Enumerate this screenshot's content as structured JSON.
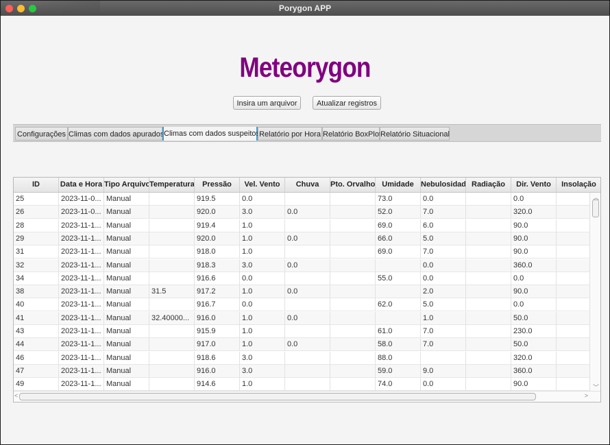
{
  "window": {
    "title": "Porygon APP"
  },
  "app": {
    "title": "Meteorygon"
  },
  "buttons": {
    "insert_file": "Insira um arquivor",
    "update_records": "Atualizar registros"
  },
  "tabs": [
    {
      "label": "Configurações",
      "active": false
    },
    {
      "label": "Climas com dados apurados",
      "active": false
    },
    {
      "label": "Climas com dados suspeitos",
      "active": true
    },
    {
      "label": "Relatório por Hora",
      "active": false
    },
    {
      "label": "Relatório BoxPlot",
      "active": false
    },
    {
      "label": "Relatório Situacional",
      "active": false
    }
  ],
  "table": {
    "columns": [
      "ID",
      "Data e Hora",
      "Tipo Arquivo",
      "Temperatura",
      "Pressão",
      "Vel. Vento",
      "Chuva",
      "Pto. Orvalho",
      "Umidade",
      "Nebulosidade",
      "Radiação",
      "Dir. Vento",
      "Insolação"
    ],
    "rows": [
      [
        "25",
        "2023-11-0...",
        "Manual",
        "",
        "919.5",
        "0.0",
        "",
        "",
        "73.0",
        "0.0",
        "",
        "0.0",
        ""
      ],
      [
        "26",
        "2023-11-0...",
        "Manual",
        "",
        "920.0",
        "3.0",
        "0.0",
        "",
        "52.0",
        "7.0",
        "",
        "320.0",
        ""
      ],
      [
        "28",
        "2023-11-1...",
        "Manual",
        "",
        "919.4",
        "1.0",
        "",
        "",
        "69.0",
        "6.0",
        "",
        "90.0",
        ""
      ],
      [
        "29",
        "2023-11-1...",
        "Manual",
        "",
        "920.0",
        "1.0",
        "0.0",
        "",
        "66.0",
        "5.0",
        "",
        "90.0",
        ""
      ],
      [
        "31",
        "2023-11-1...",
        "Manual",
        "",
        "918.0",
        "1.0",
        "",
        "",
        "69.0",
        "7.0",
        "",
        "90.0",
        ""
      ],
      [
        "32",
        "2023-11-1...",
        "Manual",
        "",
        "918.3",
        "3.0",
        "0.0",
        "",
        "",
        "0.0",
        "",
        "360.0",
        ""
      ],
      [
        "34",
        "2023-11-1...",
        "Manual",
        "",
        "916.6",
        "0.0",
        "",
        "",
        "55.0",
        "0.0",
        "",
        "0.0",
        ""
      ],
      [
        "38",
        "2023-11-1...",
        "Manual",
        "31.5",
        "917.2",
        "1.0",
        "0.0",
        "",
        "",
        "2.0",
        "",
        "90.0",
        ""
      ],
      [
        "40",
        "2023-11-1...",
        "Manual",
        "",
        "916.7",
        "0.0",
        "",
        "",
        "62.0",
        "5.0",
        "",
        "0.0",
        ""
      ],
      [
        "41",
        "2023-11-1...",
        "Manual",
        "32.40000...",
        "916.0",
        "1.0",
        "0.0",
        "",
        "",
        "1.0",
        "",
        "50.0",
        ""
      ],
      [
        "43",
        "2023-11-1...",
        "Manual",
        "",
        "915.9",
        "1.0",
        "",
        "",
        "61.0",
        "7.0",
        "",
        "230.0",
        ""
      ],
      [
        "44",
        "2023-11-1...",
        "Manual",
        "",
        "917.0",
        "1.0",
        "0.0",
        "",
        "58.0",
        "7.0",
        "",
        "50.0",
        ""
      ],
      [
        "46",
        "2023-11-1...",
        "Manual",
        "",
        "918.6",
        "3.0",
        "",
        "",
        "88.0",
        "",
        "",
        "320.0",
        ""
      ],
      [
        "47",
        "2023-11-1...",
        "Manual",
        "",
        "916.0",
        "3.0",
        "",
        "",
        "59.0",
        "9.0",
        "",
        "360.0",
        ""
      ],
      [
        "49",
        "2023-11-1...",
        "Manual",
        "",
        "914.6",
        "1.0",
        "",
        "",
        "74.0",
        "0.0",
        "",
        "90.0",
        ""
      ]
    ]
  }
}
